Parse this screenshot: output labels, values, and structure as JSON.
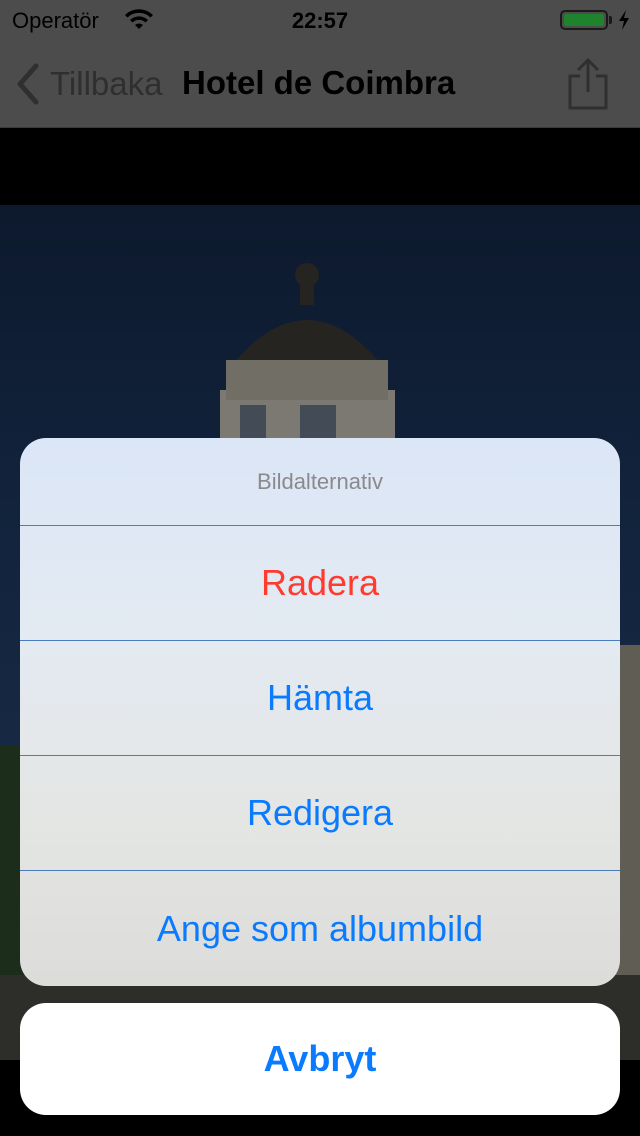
{
  "status_bar": {
    "carrier": "Operatör",
    "time": "22:57",
    "battery_level": 1.0,
    "battery_color": "#33d34a"
  },
  "nav": {
    "back_label": "Tillbaka",
    "title": "Hotel de Coimbra",
    "back_icon": "chevron-left-icon",
    "share_icon": "share-icon"
  },
  "action_sheet": {
    "title": "Bildalternativ",
    "items": [
      {
        "label": "Radera",
        "style": "destructive"
      },
      {
        "label": "Hämta",
        "style": "default"
      },
      {
        "label": "Redigera",
        "style": "default"
      },
      {
        "label": "Ange som albumbild",
        "style": "default"
      }
    ],
    "cancel_label": "Avbryt"
  },
  "colors": {
    "accent": "#0a7aff",
    "destructive": "#ff3b30"
  }
}
